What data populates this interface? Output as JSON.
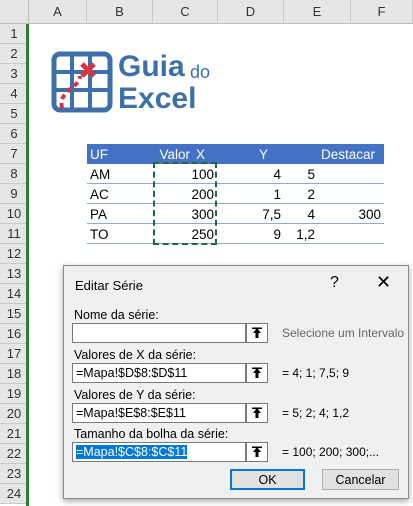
{
  "columns": [
    "A",
    "B",
    "C",
    "D",
    "E",
    "F"
  ],
  "rows": [
    "1",
    "2",
    "3",
    "4",
    "5",
    "6",
    "7",
    "8",
    "9",
    "10",
    "11",
    "12",
    "13",
    "14",
    "15",
    "16",
    "17",
    "18",
    "19",
    "20",
    "21",
    "22",
    "23",
    "24"
  ],
  "logo": {
    "line1": "Guia",
    "line1_small": "do",
    "line2": "Excel"
  },
  "table": {
    "headers": [
      "UF",
      "Valor",
      "X",
      "Y",
      "Destacar"
    ],
    "rows": [
      [
        "AM",
        "100",
        "4",
        "5",
        ""
      ],
      [
        "AC",
        "200",
        "1",
        "2",
        ""
      ],
      [
        "PA",
        "300",
        "7,5",
        "4",
        "300"
      ],
      [
        "TO",
        "250",
        "9",
        "1,2",
        ""
      ]
    ]
  },
  "dialog": {
    "title": "Editar Série",
    "help": "?",
    "close": "✕",
    "name_label": "Nome da série:",
    "name_value": "",
    "name_hint": "Selecione um Intervalo",
    "x_label": "Valores de X da série:",
    "x_value": "=Mapa!$D$8:$D$11",
    "x_result": "= 4; 1; 7,5; 9",
    "y_label": "Valores de Y da série:",
    "y_value": "=Mapa!$E$8:$E$11",
    "y_result": "= 5; 2; 4; 1,2",
    "size_label": "Tamanho da bolha da série:",
    "size_value": "=Mapa!$C$8:$C$11",
    "size_result": "= 100; 200; 300;...",
    "ok": "OK",
    "cancel": "Cancelar"
  },
  "colors": {
    "header_fill": "#4472c4",
    "accent": "#0078d7",
    "logo_blue": "#3d6fa8",
    "logo_red": "#d9333f"
  },
  "icons": [
    "range-select-icon",
    "help-icon",
    "close-icon"
  ]
}
